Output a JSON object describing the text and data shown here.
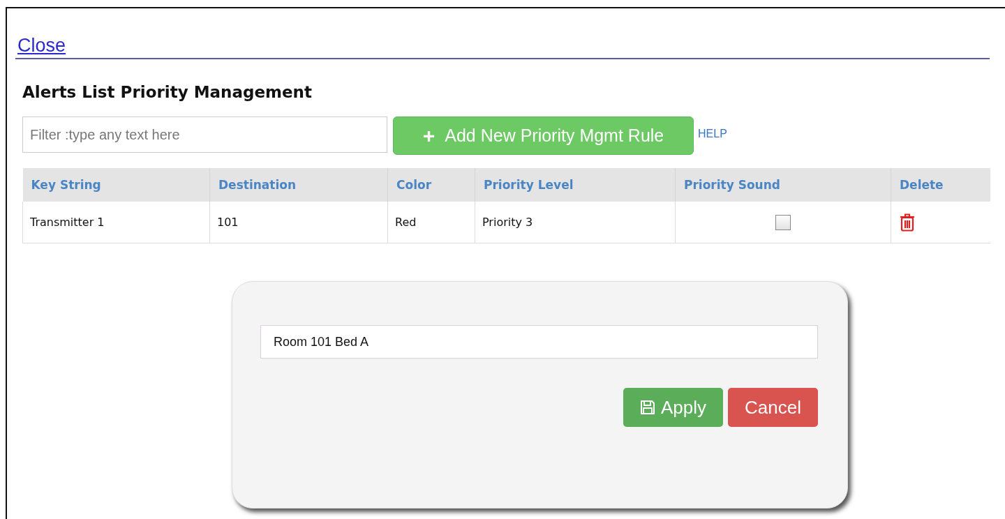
{
  "close_link": "Close",
  "title": "Alerts List Priority Management",
  "filter": {
    "placeholder": "Filter :type any text here"
  },
  "add_button": {
    "icon": "+",
    "label": "Add New Priority Mgmt Rule"
  },
  "help_link": "HELP",
  "table": {
    "columns": [
      "Key String",
      "Destination",
      "Color",
      "Priority Level",
      "Priority Sound",
      "Delete"
    ],
    "rows": [
      {
        "key_string": "Transmitter 1",
        "destination": "101",
        "color_name": "Red",
        "priority_level": "Priority 3",
        "priority_sound": false
      }
    ]
  },
  "dialog": {
    "value": "Room 101 Bed A",
    "buttons": [
      {
        "kind": "apply",
        "label": "Apply"
      },
      {
        "kind": "cancel",
        "label": "Cancel"
      }
    ]
  }
}
